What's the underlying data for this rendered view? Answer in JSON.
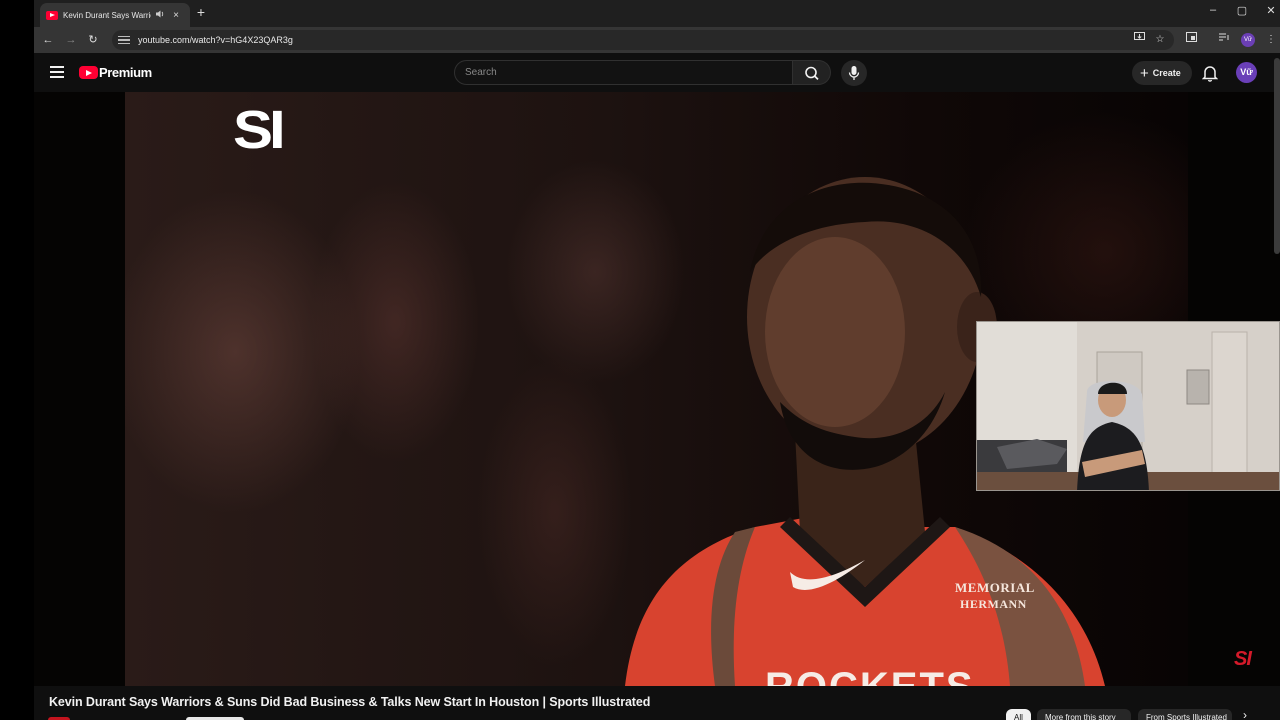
{
  "browser": {
    "tab_title": "Kevin Durant Says Warriors",
    "tab_audio_icon": "speaker-icon",
    "tab_close": "×",
    "new_tab": "+",
    "window_controls": {
      "minimize": "–",
      "maximize": "▢",
      "close": "✕"
    },
    "nav": {
      "back": "←",
      "forward": "→",
      "reload": "↻"
    },
    "url": "youtube.com/watch?v=hG4X23QAR3g",
    "profile_initials": "Vữ"
  },
  "youtube": {
    "brand": "Premium",
    "search_placeholder": "Search",
    "create_label": "Create",
    "create_plus": "+",
    "avatar_initials": "Vữ"
  },
  "video": {
    "channel_logo": "SI",
    "watermark": "SI",
    "jersey_sponsor_line1": "MEMORIAL",
    "jersey_sponsor_line2": "HERMANN",
    "jersey_team_text": "ROCKETS",
    "title": "Kevin Durant Says Warriors & Suns Did Bad Business & Talks New Start In Houston | Sports Illustrated"
  },
  "chips": {
    "all": "All",
    "more_from_story": "More from this story",
    "from_channel": "From Sports Illustrated",
    "next": "›"
  },
  "colors": {
    "youtube_red": "#ff0033",
    "jersey_red": "#d8432f",
    "background": "#0f0f0f",
    "avatar_purple": "#6a3fb8"
  }
}
